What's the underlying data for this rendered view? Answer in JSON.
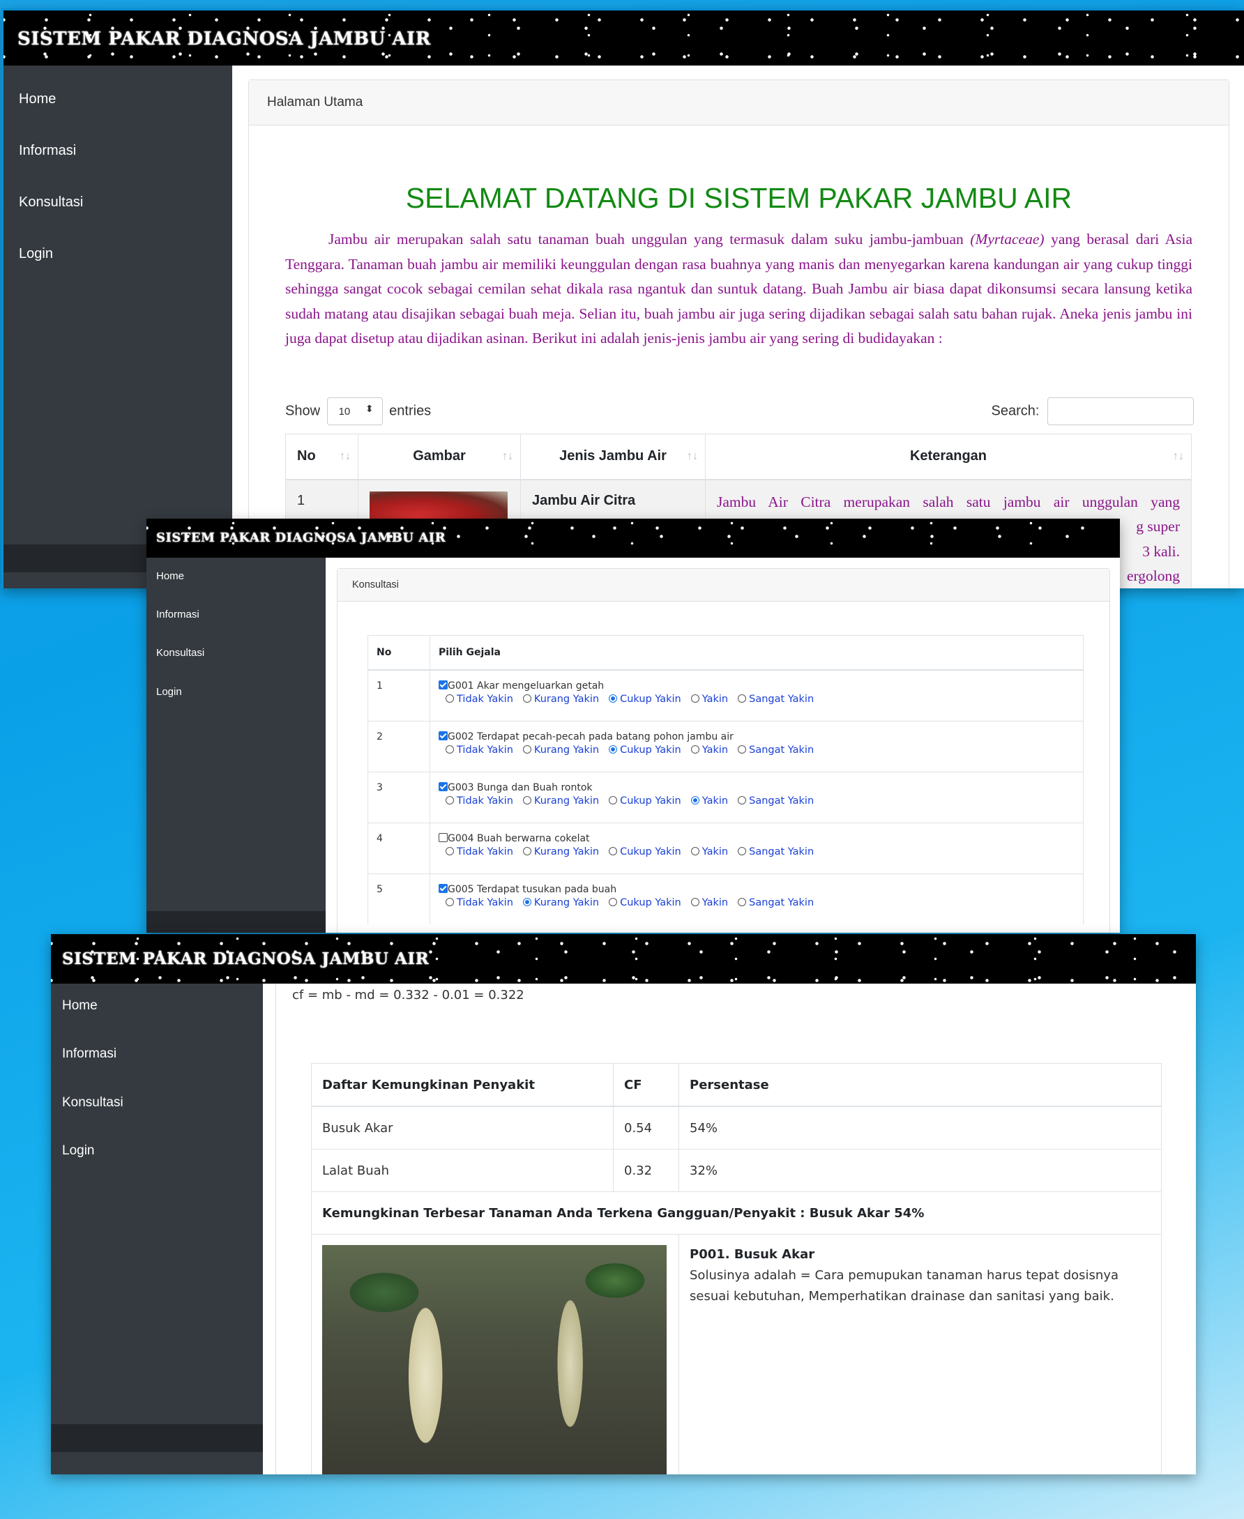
{
  "app": {
    "brand": "SISTEM PAKAR DIAGNOSA JAMBU AIR"
  },
  "nav": [
    "Home",
    "Informasi",
    "Konsultasi",
    "Login"
  ],
  "home": {
    "breadcrumb": "Halaman Utama",
    "heading": "SELAMAT DATANG DI SISTEM PAKAR JAMBU AIR",
    "intro_before_italic": "Jambu air merupakan salah satu tanaman buah unggulan yang termasuk dalam suku jambu-jambuan ",
    "intro_italic": "(Myrtaceae)",
    "intro_after_italic": " yang berasal dari Asia Tenggara. Tanaman buah jambu air memiliki keunggulan dengan rasa buahnya yang manis dan menyegarkan karena kandungan air yang cukup tinggi sehingga sangat cocok sebagai cemilan sehat dikala rasa ngantuk dan suntuk datang. Buah Jambu air biasa dapat dikonsumsi secara lansung ketika sudah matang atau disajikan sebagai buah meja. Selian itu, buah jambu air juga sering dijadikan sebagai salah satu bahan rujak. Aneka jenis jambu ini juga dapat disetup atau dijadikan asinan. Berikut ini adalah jenis-jenis jambu air yang sering di budidayakan :",
    "show_label": "Show",
    "entries_value": "10",
    "entries_label": "entries",
    "search_label": "Search:",
    "columns": [
      "No",
      "Gambar",
      "Jenis Jambu Air",
      "Keterangan"
    ],
    "row1": {
      "no": "1",
      "jenis": "Jambu Air Citra",
      "keterangan_lines": [
        "Jambu Air Citra merupakan salah satu jambu air unggulan yang",
        "g super",
        "3 kali.",
        "ergolong"
      ]
    }
  },
  "konsultasi": {
    "breadcrumb": "Konsultasi",
    "columns": [
      "No",
      "Pilih Gejala"
    ],
    "options": [
      "Tidak Yakin",
      "Kurang Yakin",
      "Cukup Yakin",
      "Yakin",
      "Sangat Yakin"
    ],
    "rows": [
      {
        "no": "1",
        "gejala": "G001 Akar mengeluarkan getah",
        "checked": true,
        "selected": 2
      },
      {
        "no": "2",
        "gejala": "G002 Terdapat pecah-pecah pada batang pohon jambu air",
        "checked": true,
        "selected": 2
      },
      {
        "no": "3",
        "gejala": "G003 Bunga dan Buah rontok",
        "checked": true,
        "selected": 3
      },
      {
        "no": "4",
        "gejala": "G004 Buah berwarna cokelat",
        "checked": false,
        "selected": -1
      },
      {
        "no": "5",
        "gejala": "G005 Terdapat tusukan pada buah",
        "checked": true,
        "selected": 1
      }
    ]
  },
  "hasil": {
    "formula": "cf = mb - md = 0.332 - 0.01 = 0.322",
    "columns": [
      "Daftar Kemungkinan Penyakit",
      "CF",
      "Persentase"
    ],
    "rows": [
      {
        "penyakit": "Busuk Akar",
        "cf": "0.54",
        "persen": "54%"
      },
      {
        "penyakit": "Lalat Buah",
        "cf": "0.32",
        "persen": "32%"
      }
    ],
    "kesimpulan": "Kemungkinan Terbesar Tanaman Anda Terkena Gangguan/Penyakit : Busuk Akar 54%",
    "penyakit_title": "P001. Busuk Akar",
    "solusi": "Solusinya adalah = Cara pemupukan tanaman harus tepat dosisnya sesuai kebutuhan, Memperhatikan drainase dan sanitasi yang baik."
  },
  "colors": {
    "sidebar": "#343a40",
    "heading_green": "#138a13",
    "intro_purple": "#8a148a",
    "option_blue": "#1a40d6"
  }
}
